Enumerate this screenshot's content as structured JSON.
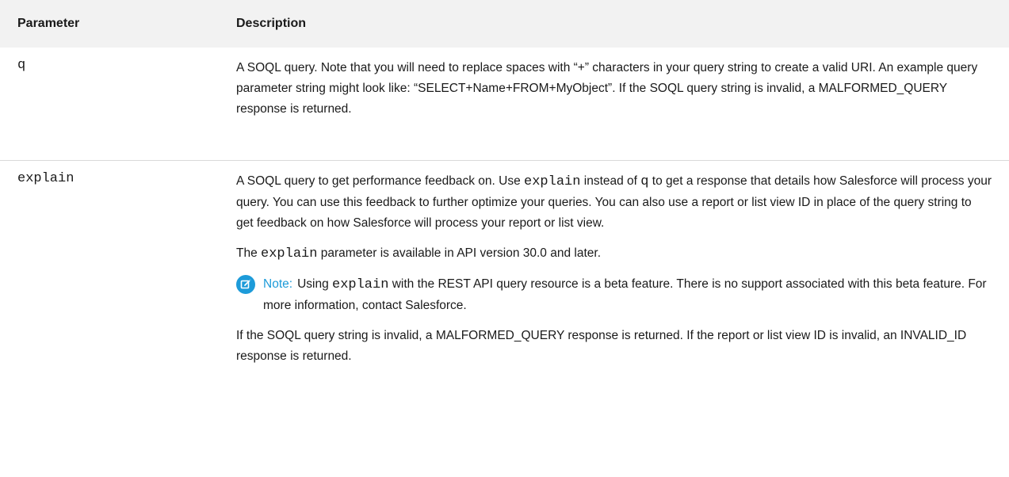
{
  "table": {
    "headers": {
      "parameter": "Parameter",
      "description": "Description"
    },
    "rows": {
      "q": {
        "name": "q",
        "desc": {
          "p1_a": "A SOQL query. Note that you will need to replace spaces with “+” characters in your query string to create a valid URI. An example query parameter string might look like: “SELECT+Name+FROM+MyObject”. If the SOQL query string is invalid, a MALFORMED_QUERY response is returned."
        }
      },
      "explain": {
        "name": "explain",
        "desc": {
          "p1_t1": "A SOQL query to get performance feedback on. Use ",
          "p1_c1": "explain",
          "p1_t2": " instead of ",
          "p1_c2": "q",
          "p1_t3": " to get a response that details how Salesforce will process your query. You can use this feedback to further optimize your queries. You can also use a report or list view ID in place of the query string to get feedback on how Salesforce will process your report or list view.",
          "p2_t1": "The ",
          "p2_c1": "explain",
          "p2_t2": " parameter is available in API version 30.0 and later.",
          "note_label": "Note:",
          "note_t1": "Using ",
          "note_c1": "explain",
          "note_t2": " with the REST API query resource is a beta feature. There is no support associated with this beta feature. For more information, contact Salesforce.",
          "p3": "If the SOQL query string is invalid, a MALFORMED_QUERY response is returned. If the report or list view ID is invalid, an INVALID_ID response is returned."
        }
      }
    }
  },
  "icons": {
    "note": "note-edit-icon"
  },
  "colors": {
    "header_bg": "#f2f2f2",
    "note_accent": "#1d9bd9",
    "row_divider": "#d9d9d9"
  }
}
